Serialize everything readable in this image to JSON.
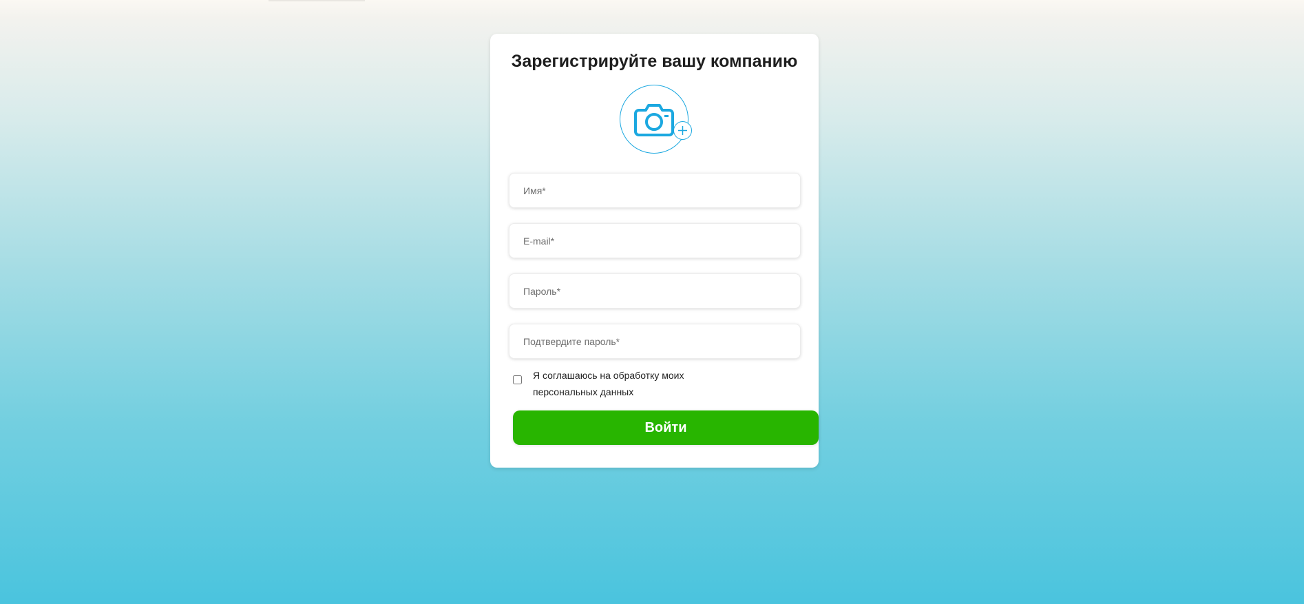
{
  "form": {
    "title": "Зарегистрируйте вашу компанию",
    "avatar": {
      "icon": "camera-icon",
      "badge_icon": "plus-icon",
      "accent_color": "#1ba8e0"
    },
    "fields": [
      {
        "placeholder": "Имя*",
        "value": ""
      },
      {
        "placeholder": "E-mail*",
        "value": ""
      },
      {
        "placeholder": "Пароль*",
        "value": ""
      },
      {
        "placeholder": "Подтвердите пароль*",
        "value": ""
      }
    ],
    "consent": {
      "label": "Я соглашаюсь на обработку моих персональных данных",
      "checked": false
    },
    "submit_label": "Войти",
    "submit_color": "#28b500"
  }
}
